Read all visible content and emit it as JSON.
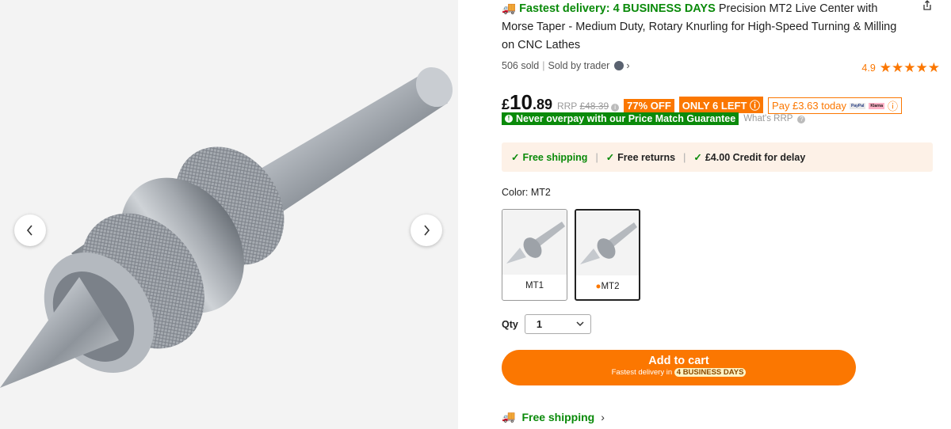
{
  "title": {
    "fast_delivery": "Fastest delivery: 4 BUSINESS DAYS",
    "product_name": "Precision MT2 Live Center with Morse Taper - Medium Duty, Rotary Knurling for High-Speed Turning & Milling on CNC Lathes"
  },
  "meta": {
    "sold": "506 sold",
    "sold_by": "Sold by trader"
  },
  "rating": {
    "score": "4.9",
    "stars": "★★★★★"
  },
  "price": {
    "currency": "£",
    "integer": "10",
    "decimal": ".89",
    "rrp_label": "RRP",
    "rrp_value": "£48.39",
    "discount": "77% OFF",
    "stock": "ONLY 6 LEFT",
    "pay_today": "Pay £3.63 today",
    "paypal": "PayPal",
    "klarna": "Klarna"
  },
  "guarantee": {
    "text": "Never overpay with our Price Match Guarantee",
    "whats_rrp": "What's RRP"
  },
  "shipping_box": {
    "free_shipping": "Free shipping",
    "free_returns": "Free returns",
    "credit": "£4.00 Credit for delay"
  },
  "color": {
    "label": "Color: MT2",
    "options": [
      {
        "label": "MT1"
      },
      {
        "label": "MT2"
      }
    ]
  },
  "qty": {
    "label": "Qty",
    "value": "1"
  },
  "cart": {
    "label": "Add to cart",
    "sub_prefix": "Fastest delivery in",
    "sub_days": "4 BUSINESS DAYS"
  },
  "free_shipping_link": "Free shipping",
  "icons": {
    "prev": "chevron-left-icon",
    "next": "chevron-right-icon",
    "share": "share-icon",
    "truck": "truck-icon"
  },
  "colors": {
    "accent": "#fb7701",
    "green": "#0a8a0a",
    "ship_bg": "#fdf1e7"
  }
}
